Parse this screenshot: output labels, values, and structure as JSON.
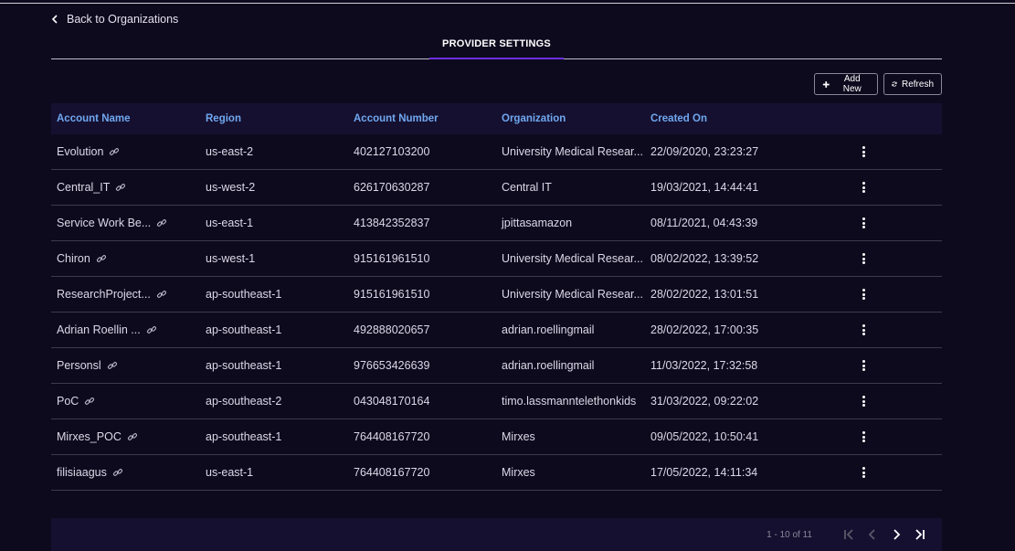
{
  "nav": {
    "back_label": "Back to Organizations"
  },
  "tabs": [
    {
      "label": "PROVIDER SETTINGS"
    }
  ],
  "toolbar": {
    "add_label": "Add New",
    "refresh_label": "Refresh"
  },
  "table": {
    "columns": [
      "Account Name",
      "Region",
      "Account Number",
      "Organization",
      "Created On"
    ],
    "rows": [
      {
        "name": "Evolution",
        "region": "us-east-2",
        "account": "402127103200",
        "org": "University Medical Resear...",
        "created": "22/09/2020, 23:23:27"
      },
      {
        "name": "Central_IT",
        "region": "us-west-2",
        "account": "626170630287",
        "org": "Central IT",
        "created": "19/03/2021, 14:44:41"
      },
      {
        "name": "Service Work Be...",
        "region": "us-east-1",
        "account": "413842352837",
        "org": "jpittasamazon",
        "created": "08/11/2021, 04:43:39"
      },
      {
        "name": "Chiron",
        "region": "us-west-1",
        "account": "915161961510",
        "org": "University Medical Resear...",
        "created": "08/02/2022, 13:39:52"
      },
      {
        "name": "ResearchProject...",
        "region": "ap-southeast-1",
        "account": "915161961510",
        "org": "University Medical Resear...",
        "created": "28/02/2022, 13:01:51"
      },
      {
        "name": "Adrian Roellin ...",
        "region": "ap-southeast-1",
        "account": "492888020657",
        "org": "adrian.roellingmail",
        "created": "28/02/2022, 17:00:35"
      },
      {
        "name": "Personsl",
        "region": "ap-southeast-1",
        "account": "976653426639",
        "org": "adrian.roellingmail",
        "created": "11/03/2022, 17:32:58"
      },
      {
        "name": "PoC",
        "region": "ap-southeast-2",
        "account": "043048170164",
        "org": "timo.lassmanntelethonkids",
        "created": "31/03/2022, 09:22:02"
      },
      {
        "name": "Mirxes_POC",
        "region": "ap-southeast-1",
        "account": "764408167720",
        "org": "Mirxes",
        "created": "09/05/2022, 10:50:41"
      },
      {
        "name": "filisiaagus",
        "region": "us-east-1",
        "account": "764408167720",
        "org": "Mirxes",
        "created": "17/05/2022, 14:11:34"
      }
    ]
  },
  "pagination": {
    "range_label": "1 - 10 of 11"
  },
  "icons": {
    "back": "chevron-left-icon",
    "add": "plus-icon",
    "refresh": "refresh-icon",
    "row_link": "link-icon",
    "row_menu": "kebab-menu-icon",
    "first": "first-page-icon",
    "prev": "prev-page-icon",
    "next": "next-page-icon",
    "last": "last-page-icon"
  },
  "colors": {
    "background": "#0e0a1e",
    "accent": "#6a2ee0",
    "header_text": "#6fa8f0"
  }
}
